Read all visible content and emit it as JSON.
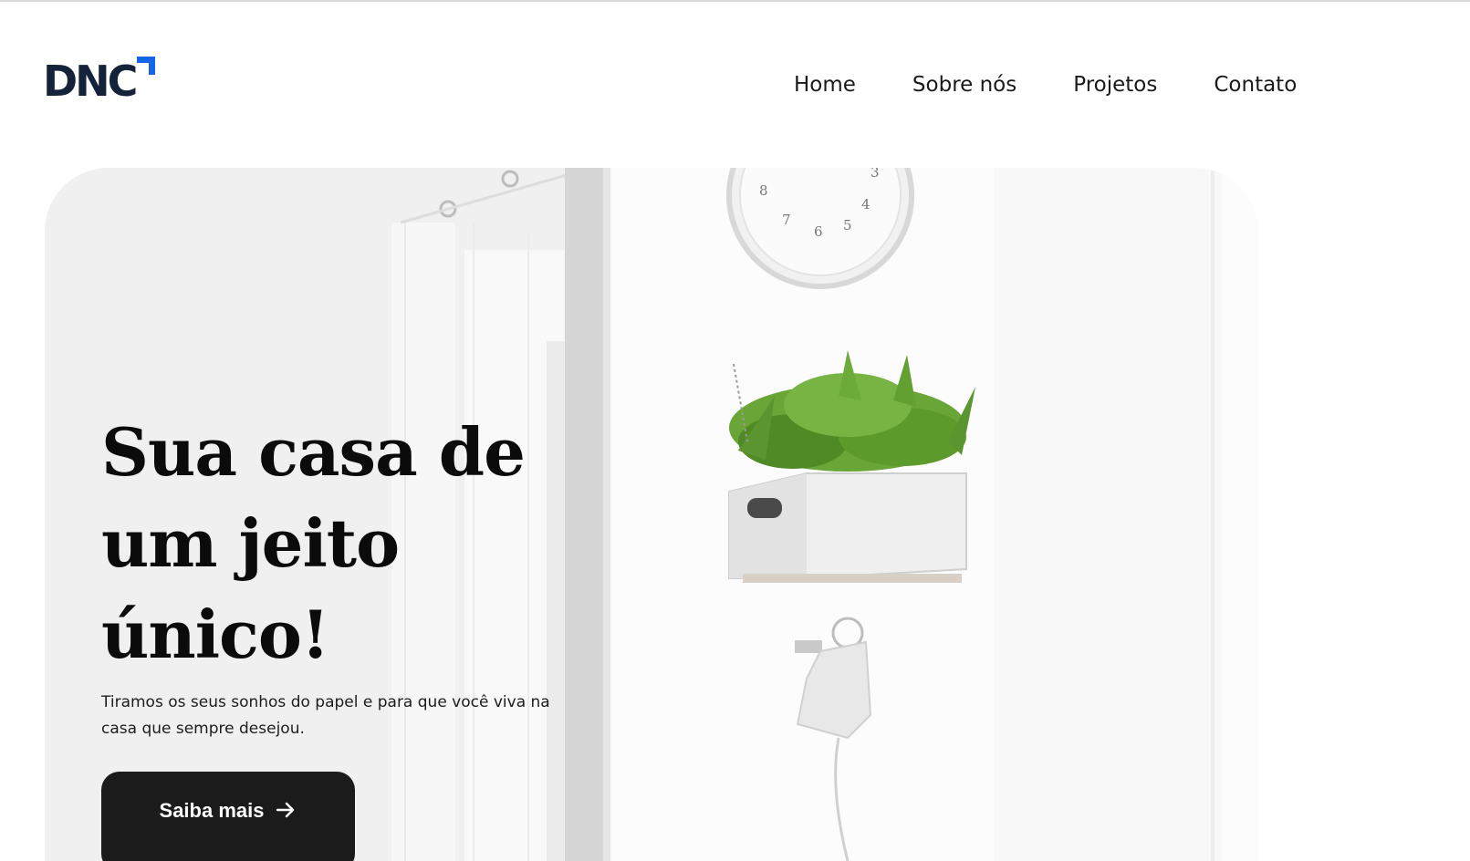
{
  "brand": {
    "logo_text": "DNC",
    "text_color": "#15233a",
    "accent_color": "#1665e8"
  },
  "nav": {
    "items": [
      {
        "label": "Home"
      },
      {
        "label": "Sobre nós"
      },
      {
        "label": "Projetos"
      },
      {
        "label": "Contato"
      }
    ]
  },
  "hero": {
    "title_lines": [
      "Sua casa de",
      "um jeito",
      "único!"
    ],
    "subtitle": "Tiramos os seus sonhos do papel e para que você viva na casa que sempre desejou.",
    "cta_label": "Saiba mais",
    "cta_icon": "arrow-right-icon",
    "clock_numerals": [
      "8",
      "7",
      "6",
      "5",
      "4",
      "3"
    ],
    "image_objects": [
      "wall-clock",
      "plant-crate-shelf",
      "wall-lamp",
      "curtains"
    ]
  }
}
